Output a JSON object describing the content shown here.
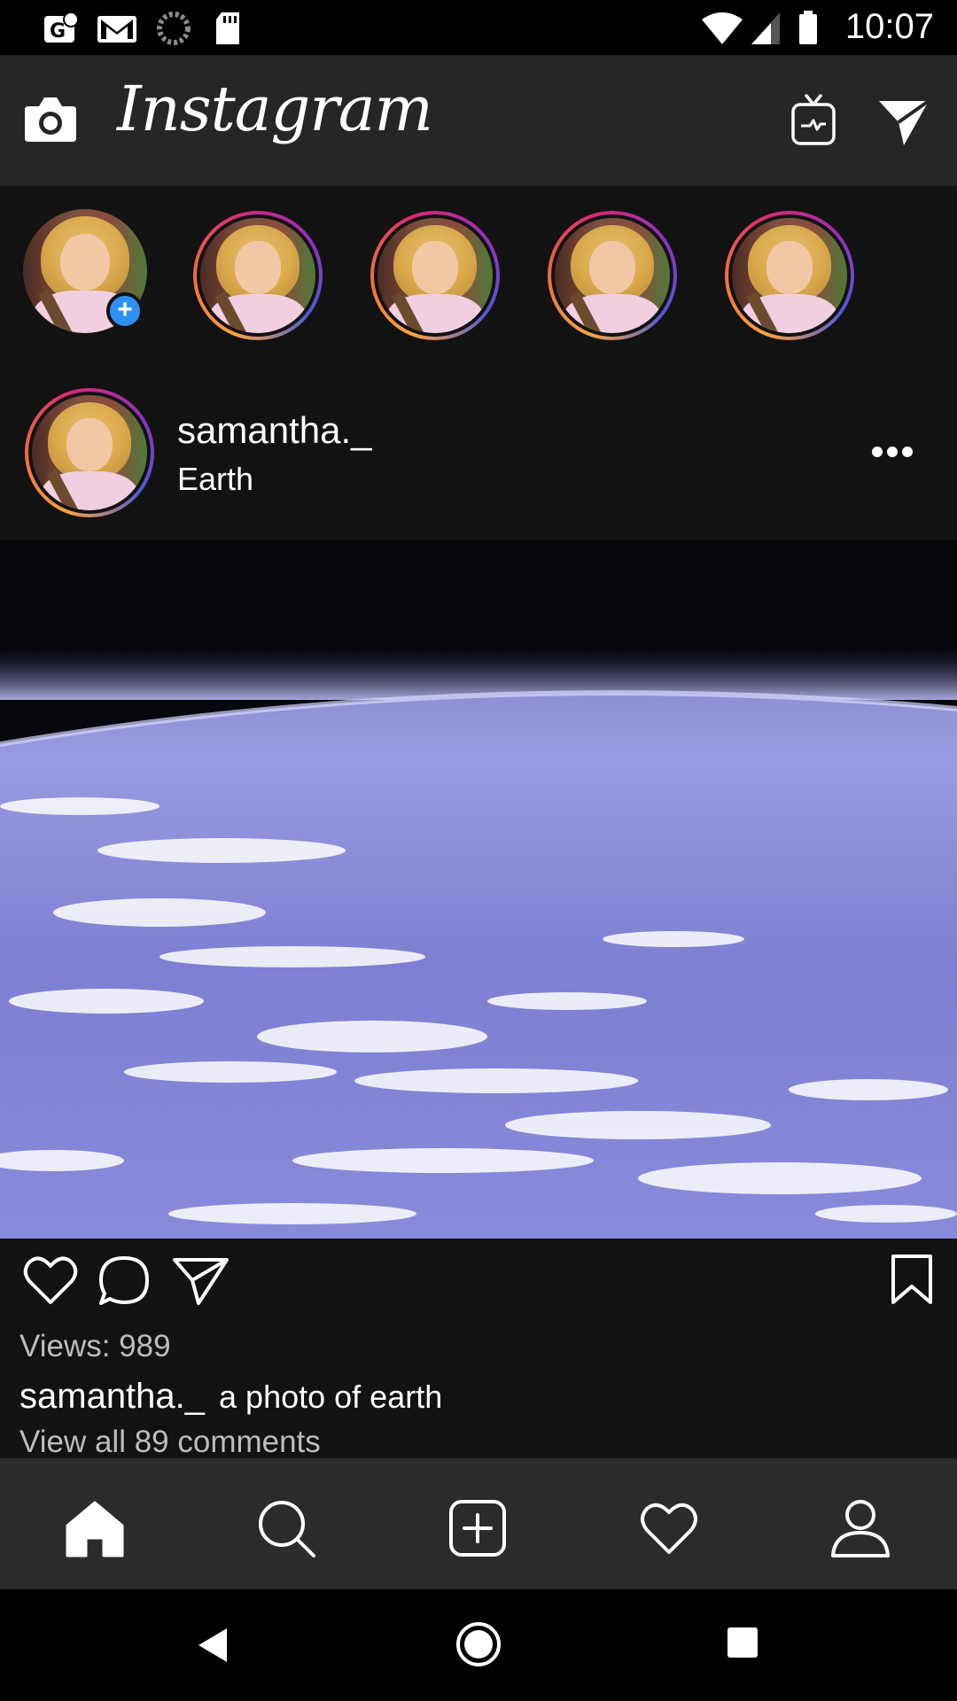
{
  "status_bar": {
    "time": "10:07",
    "icons": [
      "google-fit-icon",
      "gmail-icon",
      "sync-icon",
      "sd-card-icon",
      "wifi-icon",
      "signal-icon",
      "battery-icon"
    ]
  },
  "header": {
    "title": "Instagram",
    "icons": [
      "camera-icon",
      "igtv-icon",
      "direct-message-icon"
    ]
  },
  "stories": [
    {
      "type": "own",
      "badge": "+"
    },
    {
      "type": "friend"
    },
    {
      "type": "friend"
    },
    {
      "type": "friend"
    },
    {
      "type": "friend"
    }
  ],
  "post": {
    "username": "samantha._",
    "location": "Earth",
    "views": "Views: 989",
    "caption_user": "samantha._",
    "caption_text": "a photo of earth",
    "comments_link": "View all 89 comments"
  },
  "bottom_nav": [
    "home-icon",
    "search-icon",
    "add-post-icon",
    "activity-heart-icon",
    "profile-icon"
  ],
  "colors": {
    "header_bg": "#262626",
    "feed_bg": "#121212",
    "nav_bg": "#2b2b2b",
    "badge_blue": "#2f8ff7"
  }
}
